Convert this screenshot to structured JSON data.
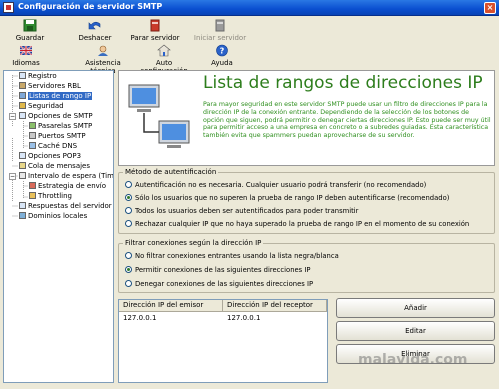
{
  "window": {
    "title": "Configuración de servidor SMTP"
  },
  "toolbar": {
    "row1": [
      {
        "label": "Guardar",
        "icon": "save-icon",
        "enabled": true
      },
      {
        "label": "Deshacer",
        "icon": "undo-icon",
        "enabled": true
      },
      {
        "label": "Parar servidor",
        "icon": "stop-server-icon",
        "enabled": true
      },
      {
        "label": "Iniciar servidor",
        "icon": "start-server-icon",
        "enabled": false
      }
    ],
    "row2": [
      {
        "label": "Idiomas",
        "icon": "flag-icon"
      },
      {
        "label": "Asistencia técnica",
        "icon": "support-icon"
      },
      {
        "label": "Auto configuración",
        "icon": "autoconfig-icon"
      },
      {
        "label": "Ayuda",
        "icon": "help-icon"
      }
    ]
  },
  "tree": {
    "items": [
      {
        "label": "Registro",
        "selected": false
      },
      {
        "label": "Servidores RBL",
        "selected": false
      },
      {
        "label": "Listas de rango IP",
        "selected": true
      },
      {
        "label": "Seguridad",
        "selected": false
      },
      {
        "label": "Opciones de SMTP",
        "selected": false
      },
      {
        "label": "Pasarelas SMTP",
        "selected": false
      },
      {
        "label": "Puertos SMTP",
        "selected": false
      },
      {
        "label": "Caché DNS",
        "selected": false
      },
      {
        "label": "Opciones POP3",
        "selected": false
      },
      {
        "label": "Cola de mensajes",
        "selected": false
      },
      {
        "label": "Intervalo de espera (Timeo",
        "selected": false
      },
      {
        "label": "Estrategia de envío",
        "selected": false
      },
      {
        "label": "Throttling",
        "selected": false
      },
      {
        "label": "Respuestas del servidor",
        "selected": false
      },
      {
        "label": "Dominios locales",
        "selected": false
      }
    ]
  },
  "banner": {
    "title": "Lista de rangos de direcciones IP",
    "description": "Para mayor seguridad en este servidor SMTP puede usar un filtro de direcciones IP para la dirección IP de la conexión entrante. Dependiendo de la selección de los botones de opción que siguen, podrá permitir o denegar ciertas direcciones IP. Esto puede ser muy útil para permitir acceso a una empresa en concreto o a subredes guiadas. Esta característica también evita que spammers puedan aprovecharse de su servidor."
  },
  "auth_group": {
    "title": "Método de autentificación",
    "options": [
      {
        "label": "Autentificación no es necesaria. Cualquier usuario podrá transferir (no recomendado)",
        "checked": false
      },
      {
        "label": "Sólo los usuarios que no superen la prueba de rango IP deben autentificarse (recomendado)",
        "checked": true
      },
      {
        "label": "Todos los usuarios deben ser autentificados para poder transmitir",
        "checked": false
      },
      {
        "label": "Rechazar cualquier IP que no haya superado la prueba de rango IP en el momento de su conexión",
        "checked": false
      }
    ]
  },
  "filter_group": {
    "title": "Filtrar conexiones según la dirección IP",
    "options": [
      {
        "label": "No filtrar conexiones entrantes usando la lista negra/blanca",
        "checked": false
      },
      {
        "label": "Permitir conexiones de las siguientes direcciones IP",
        "checked": true
      },
      {
        "label": "Denegar conexiones de las siguientes direcciones IP",
        "checked": false
      }
    ]
  },
  "ip_table": {
    "columns": [
      "Dirección IP del emisor",
      "Dirección IP del receptor"
    ],
    "rows": [
      [
        "127.0.0.1",
        "127.0.0.1"
      ]
    ]
  },
  "buttons": {
    "add": "Añadir",
    "edit": "Editar",
    "delete": "Eliminar"
  },
  "watermark": "malavida.com",
  "colors": {
    "title_bar": "#0a4fd0",
    "banner_title": "#2d7d1c",
    "selection": "#316ac5"
  }
}
